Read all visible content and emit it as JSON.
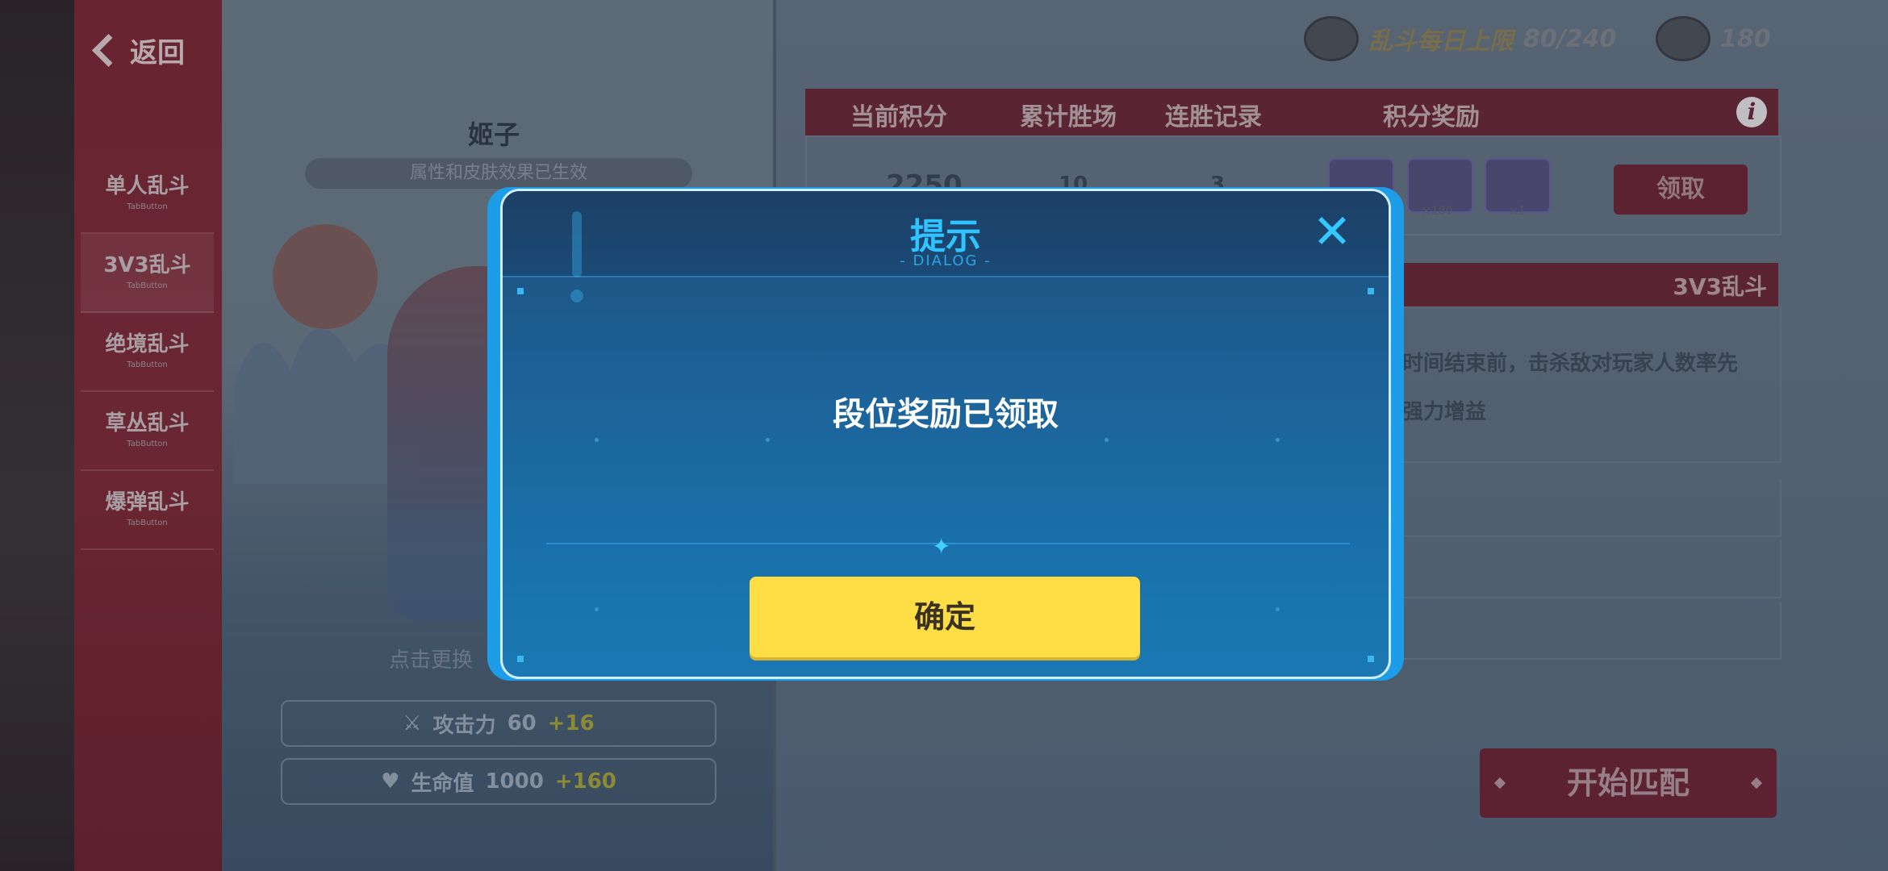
{
  "nav": {
    "back_label": "返回",
    "items": [
      {
        "label": "单人乱斗",
        "sub": "TabButton"
      },
      {
        "label": "3V3乱斗",
        "sub": "TabButton"
      },
      {
        "label": "绝境乱斗",
        "sub": "TabButton"
      },
      {
        "label": "草丛乱斗",
        "sub": "TabButton"
      },
      {
        "label": "爆弹乱斗",
        "sub": "TabButton"
      }
    ]
  },
  "character": {
    "name": "姬子",
    "subtitle": "属性和皮肤效果已生效",
    "tap_hint": "点击更换",
    "attack_label": "攻击力",
    "attack_value": "60",
    "attack_bonus": "+16",
    "hp_label": "生命值",
    "hp_value": "1000",
    "hp_bonus": "+160"
  },
  "currency": {
    "daily_limit_label": "乱斗每日上限",
    "daily_limit_value": "80/240",
    "coins": "180"
  },
  "score_table": {
    "headers": [
      "当前积分",
      "累计胜场",
      "连胜记录",
      "积分奖励"
    ],
    "current_score": "2250",
    "total_wins": "10",
    "win_streak": "3",
    "reward_counts": [
      "×180",
      "×1"
    ],
    "claim_label": "领取"
  },
  "mode_panel": {
    "title": "3V3乱斗",
    "desc_line1": "在时间结束前，击杀敌对玩家人数率先",
    "desc_line2": "量强力增益"
  },
  "start_match_label": "开始匹配",
  "dialog": {
    "title": "提示",
    "subtitle": "- DIALOG -",
    "message": "段位奖励已领取",
    "confirm_label": "确定"
  }
}
